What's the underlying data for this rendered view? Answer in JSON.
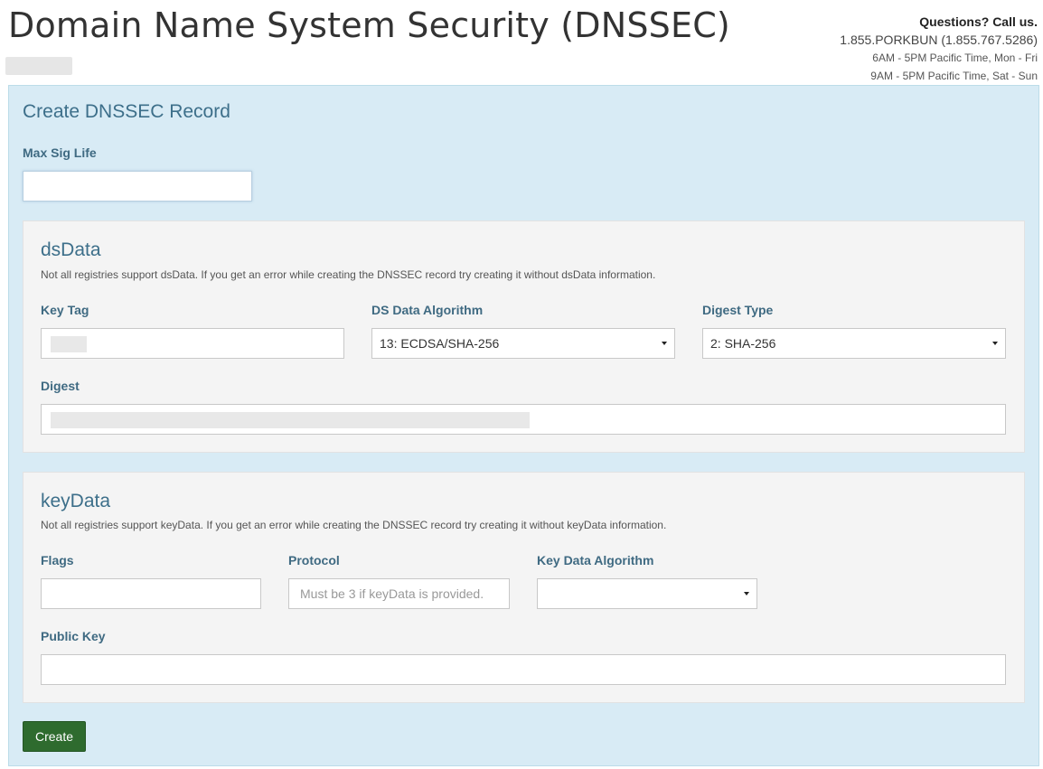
{
  "header": {
    "title": "Domain Name System Security (DNSSEC)",
    "contact": {
      "question": "Questions? Call us.",
      "phone": "1.855.PORKBUN (1.855.767.5286)",
      "hours_weekday": "6AM - 5PM Pacific Time, Mon - Fri",
      "hours_weekend": "9AM - 5PM Pacific Time, Sat - Sun"
    }
  },
  "form": {
    "title": "Create DNSSEC Record",
    "max_sig_life": {
      "label": "Max Sig Life",
      "value": ""
    },
    "ds_data": {
      "title": "dsData",
      "note": "Not all registries support dsData. If you get an error while creating the DNSSEC record try creating it without dsData information.",
      "key_tag": {
        "label": "Key Tag"
      },
      "algorithm": {
        "label": "DS Data Algorithm",
        "selected": "13: ECDSA/SHA-256"
      },
      "digest_type": {
        "label": "Digest Type",
        "selected": "2: SHA-256"
      },
      "digest": {
        "label": "Digest"
      }
    },
    "key_data": {
      "title": "keyData",
      "note": "Not all registries support keyData. If you get an error while creating the DNSSEC record try creating it without keyData information.",
      "flags": {
        "label": "Flags",
        "value": ""
      },
      "protocol": {
        "label": "Protocol",
        "placeholder": "Must be 3 if keyData is provided."
      },
      "algorithm": {
        "label": "Key Data Algorithm",
        "selected": ""
      },
      "public_key": {
        "label": "Public Key",
        "value": ""
      }
    },
    "create_label": "Create"
  },
  "colors": {
    "panel_bg": "#d8ebf5",
    "subpanel_bg": "#f4f4f4",
    "label": "#3f6a82",
    "create_button": "#2e6b2e"
  },
  "icons": {
    "select_arrow": "chevron-down-icon"
  }
}
